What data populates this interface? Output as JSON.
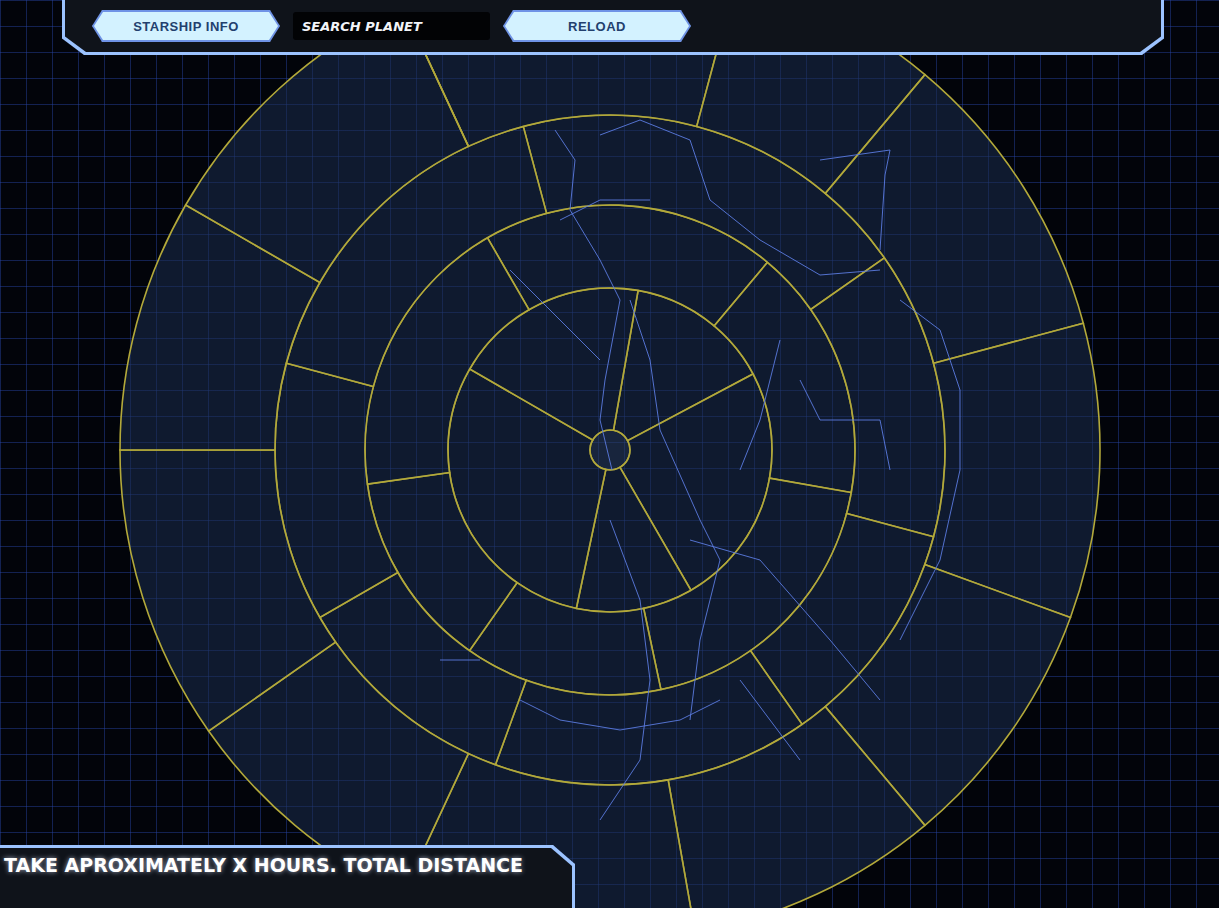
{
  "toolbar": {
    "items": [
      {
        "kind": "button",
        "label": "STARSHIP INFO"
      },
      {
        "kind": "search",
        "placeholder": "SEARCH PLANET"
      },
      {
        "kind": "button",
        "label": "RELOAD"
      }
    ]
  },
  "status_bar": {
    "text": "TAKE APROXIMATELY X HOURS. TOTAL DISTANCE"
  }
}
